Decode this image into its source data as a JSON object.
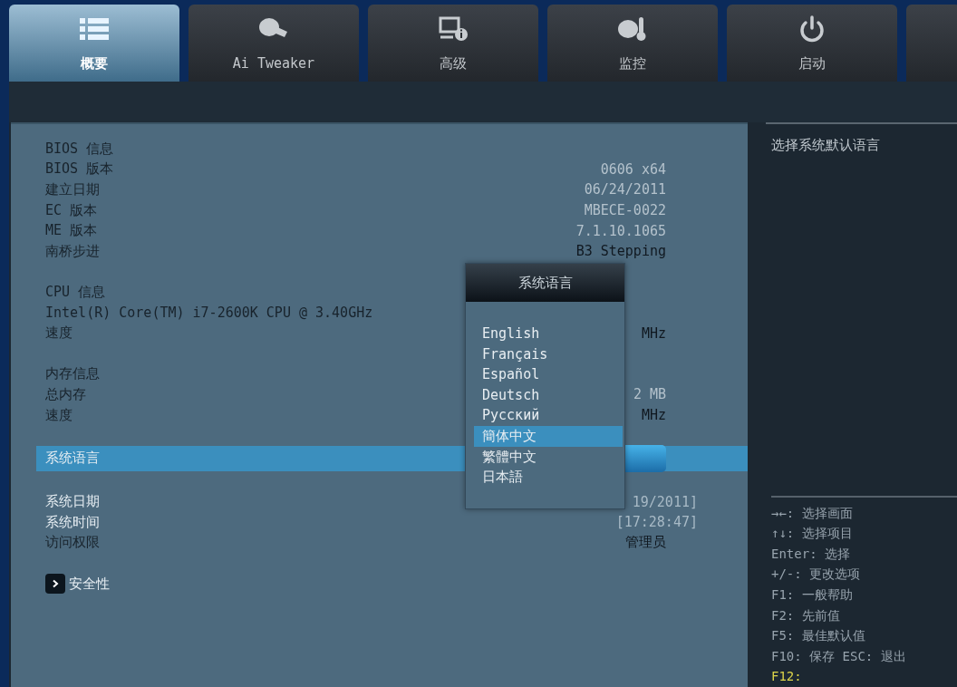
{
  "tabs": [
    {
      "label": "概要",
      "selected": true
    },
    {
      "label": "Ai Tweaker",
      "selected": false
    },
    {
      "label": "高级",
      "selected": false
    },
    {
      "label": "监控",
      "selected": false
    },
    {
      "label": "启动",
      "selected": false
    }
  ],
  "main": {
    "sections": [
      {
        "items": [
          {
            "kind": "info",
            "label": "BIOS 信息",
            "selected": false
          },
          {
            "kind": "info",
            "label": "BIOS 版本",
            "value": "0606 x64",
            "selected": false
          },
          {
            "kind": "info",
            "label": "建立日期",
            "value": "06/24/2011",
            "selected": false
          },
          {
            "kind": "info",
            "label": "EC 版本",
            "value": "MBECE-0022",
            "selected": false
          },
          {
            "kind": "info",
            "label": "ME 版本",
            "value": "7.1.10.1065",
            "selected": false
          },
          {
            "kind": "info",
            "label": "南桥步进",
            "value": "B3 Stepping",
            "selected": false
          }
        ]
      },
      {
        "items": [
          {
            "kind": "info",
            "label": "CPU 信息",
            "selected": false
          },
          {
            "kind": "info",
            "label": "Intel(R) Core(TM) i7-2600K CPU @ 3.40GHz",
            "selected": false
          },
          {
            "kind": "info",
            "label": "速度",
            "value": "MHz",
            "selected": false
          }
        ]
      },
      {
        "items": [
          {
            "kind": "info",
            "label": "内存信息",
            "selected": false
          },
          {
            "kind": "info",
            "label": "总内存",
            "value": "2 MB",
            "selected": false
          },
          {
            "kind": "info",
            "label": "速度",
            "value": "MHz",
            "selected": false
          }
        ]
      },
      {
        "items": [
          {
            "kind": "select",
            "label": "系统语言",
            "selected": true
          }
        ]
      },
      {
        "items": [
          {
            "kind": "editable",
            "label": "系统日期",
            "value": "19/2011]",
            "selected": false
          },
          {
            "kind": "editable",
            "label": "系统时间",
            "value": "[17:28:47]",
            "selected": false
          },
          {
            "kind": "info",
            "label": "访问权限",
            "value": "管理员",
            "selected": false
          }
        ]
      },
      {
        "items": [
          {
            "kind": "submenu",
            "label": "安全性",
            "selected": false
          }
        ]
      }
    ]
  },
  "language_popup": {
    "title": "系统语言",
    "options": [
      {
        "label": "English",
        "selected": false
      },
      {
        "label": "Français",
        "selected": false
      },
      {
        "label": "Español",
        "selected": false
      },
      {
        "label": "Deutsch",
        "selected": false
      },
      {
        "label": "Русский",
        "selected": false
      },
      {
        "label": "簡体中文",
        "selected": true
      },
      {
        "label": "繁體中文",
        "selected": false
      },
      {
        "label": "日本語",
        "selected": false
      }
    ]
  },
  "help": {
    "text": "选择系统默认语言"
  },
  "key_hints": [
    {
      "text": "→←: 选择画面",
      "highlighted": false
    },
    {
      "text": "↑↓: 选择项目",
      "highlighted": false
    },
    {
      "text": "Enter: 选择",
      "highlighted": false
    },
    {
      "text": "+/-: 更改选项",
      "highlighted": false
    },
    {
      "text": "F1: 一般帮助",
      "highlighted": false
    },
    {
      "text": "F2: 先前值",
      "highlighted": false
    },
    {
      "text": "F5: 最佳默认值",
      "highlighted": false
    },
    {
      "text": "F10: 保存  ESC: 退出",
      "highlighted": false
    },
    {
      "text": "F12:",
      "highlighted": true
    }
  ]
}
